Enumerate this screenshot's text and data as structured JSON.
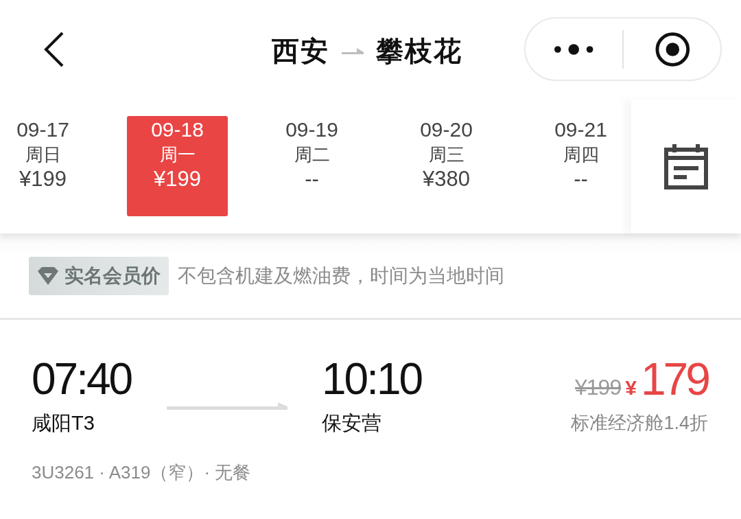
{
  "header": {
    "from": "西安",
    "to": "攀枝花"
  },
  "date_strip": {
    "dates": [
      {
        "date": "09-17",
        "weekday": "周日",
        "price": "¥199",
        "selected": false
      },
      {
        "date": "09-18",
        "weekday": "周一",
        "price": "¥199",
        "selected": true
      },
      {
        "date": "09-19",
        "weekday": "周二",
        "price": "--",
        "selected": false
      },
      {
        "date": "09-20",
        "weekday": "周三",
        "price": "¥380",
        "selected": false
      },
      {
        "date": "09-21",
        "weekday": "周四",
        "price": "--",
        "selected": false
      }
    ]
  },
  "notice": {
    "badge": "实名会员价",
    "text": "不包含机建及燃油费，时间为当地时间"
  },
  "flights": [
    {
      "departure_time": "07:40",
      "departure_airport": "咸阳T3",
      "arrival_time": "10:10",
      "arrival_airport": "保安营",
      "original_price": "¥199",
      "currency": "¥",
      "price": "179",
      "cabin": "标准经济舱1.4折",
      "details": "3U3261 · A319（窄）· 无餐"
    }
  ]
}
